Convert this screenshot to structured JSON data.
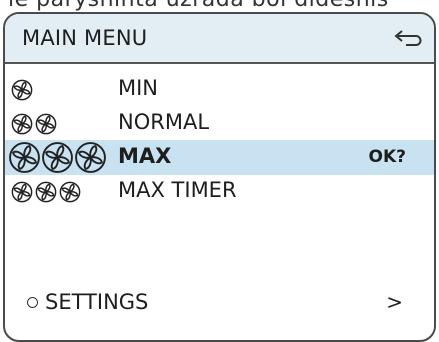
{
  "page_text_fragment": "ie paryshinta uzrada bol didesnis",
  "header": {
    "title": "MAIN MENU",
    "back_icon": "return-arrow-icon"
  },
  "menu": {
    "items": [
      {
        "label": "MIN",
        "fans": 1,
        "selected": false,
        "status": ""
      },
      {
        "label": "NORMAL",
        "fans": 2,
        "selected": false,
        "status": ""
      },
      {
        "label": "MAX",
        "fans": 3,
        "selected": true,
        "status": "OK?"
      },
      {
        "label": "MAX TIMER",
        "fans": 3,
        "selected": false,
        "status": ""
      }
    ]
  },
  "settings": {
    "label": "SETTINGS",
    "arrow": ">"
  },
  "colors": {
    "header_bg": "#e2edf4",
    "selected_bg": "#c8e2f1",
    "border": "#4b4b4b"
  }
}
